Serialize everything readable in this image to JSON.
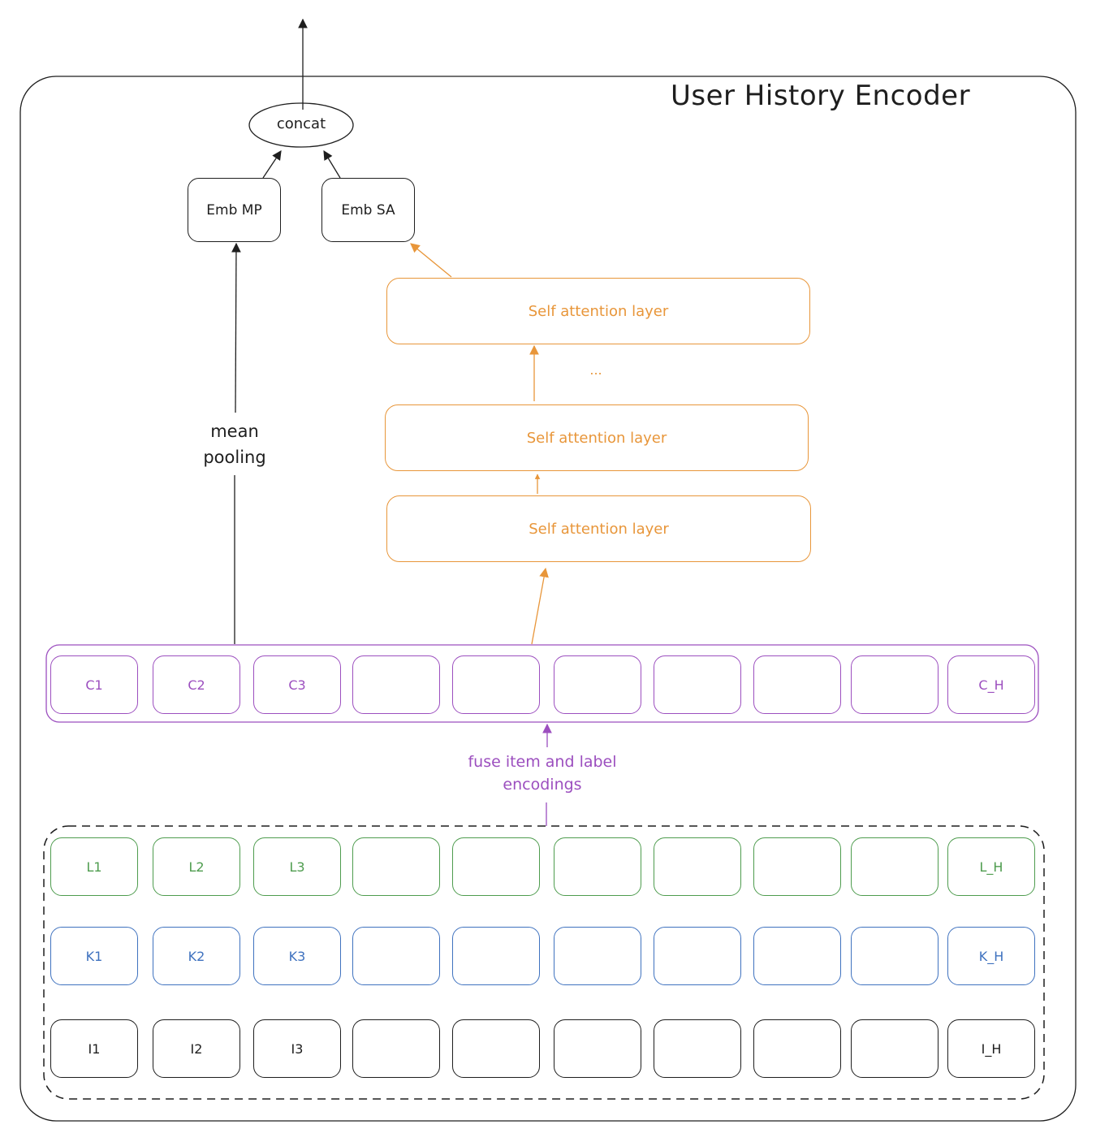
{
  "title": "User History Encoder",
  "colors": {
    "stroke": "#1e1e1e",
    "orange": "#e8963a",
    "purple": "#9c4fbf",
    "green": "#4e9c4e",
    "blue": "#3f72bf",
    "black": "#1e1e1e"
  },
  "top": {
    "concat_label": "concat",
    "emb_mp_label": "Emb MP",
    "emb_sa_label": "Emb SA"
  },
  "mean_pooling": {
    "line1": "mean",
    "line2": "pooling"
  },
  "attention": {
    "layers": [
      "Self attention layer",
      "Self attention layer",
      "Self attention layer"
    ],
    "ellipsis": "..."
  },
  "fuse_label": {
    "line1": "fuse item and label",
    "line2": "encodings"
  },
  "rows": {
    "combined": [
      "C1",
      "C2",
      "C3",
      "",
      "",
      "",
      "",
      "",
      "",
      "C_H"
    ],
    "labels": [
      "L1",
      "L2",
      "L3",
      "",
      "",
      "",
      "",
      "",
      "",
      "L_H"
    ],
    "keys": [
      "K1",
      "K2",
      "K3",
      "",
      "",
      "",
      "",
      "",
      "",
      "K_H"
    ],
    "items": [
      "I1",
      "I2",
      "I3",
      "",
      "",
      "",
      "",
      "",
      "",
      "I_H"
    ]
  }
}
